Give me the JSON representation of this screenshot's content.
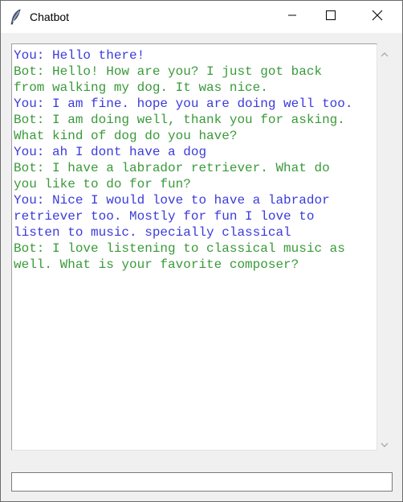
{
  "window": {
    "title": "Chatbot",
    "icon": "feather-icon"
  },
  "controls": {
    "minimize_icon": "minimize-icon",
    "maximize_icon": "maximize-icon",
    "close_icon": "close-icon"
  },
  "chat": {
    "messages": [
      {
        "speaker": "user",
        "text": "You: Hello there!"
      },
      {
        "speaker": "bot",
        "text": "Bot: Hello! How are you? I just got back\nfrom walking my dog. It was nice."
      },
      {
        "speaker": "user",
        "text": "You: I am fine. hope you are doing well too."
      },
      {
        "speaker": "bot",
        "text": "Bot: I am doing well, thank you for asking.\nWhat kind of dog do you have?"
      },
      {
        "speaker": "user",
        "text": "You: ah I dont have a dog"
      },
      {
        "speaker": "bot",
        "text": "Bot: I have a labrador retriever. What do\nyou like to do for fun?"
      },
      {
        "speaker": "user",
        "text": "You: Nice I would love to have a labrador\nretriever too. Mostly for fun I love to\nlisten to music. specially classical"
      },
      {
        "speaker": "bot",
        "text": "Bot: I love listening to classical music as\nwell. What is your favorite composer?"
      }
    ],
    "colors": {
      "user": "#3b3bdb",
      "bot": "#3a9a3a"
    }
  },
  "input": {
    "value": "",
    "placeholder": ""
  }
}
